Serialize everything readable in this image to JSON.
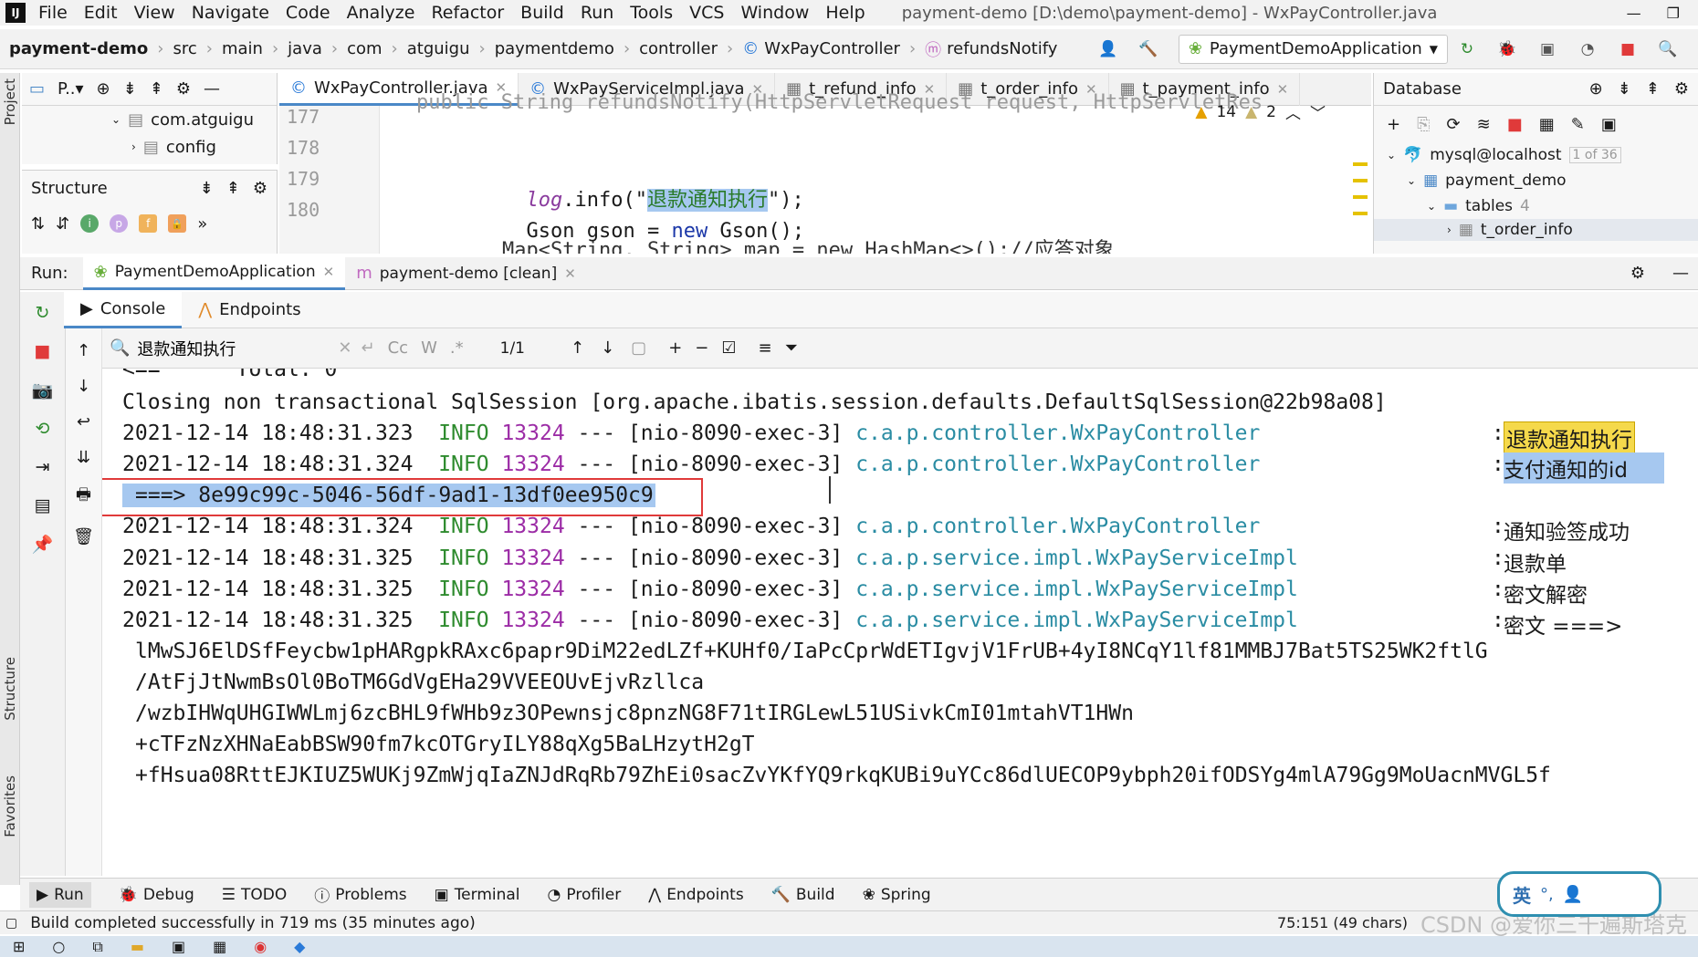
{
  "window": {
    "app_icon": "IJ",
    "menu": [
      "File",
      "Edit",
      "View",
      "Navigate",
      "Code",
      "Analyze",
      "Refactor",
      "Build",
      "Run",
      "Tools",
      "VCS",
      "Window",
      "Help"
    ],
    "title": "payment-demo [D:\\demo\\payment-demo] - WxPayController.java"
  },
  "breadcrumb": [
    "payment-demo",
    "src",
    "main",
    "java",
    "com",
    "atguigu",
    "paymentdemo",
    "controller",
    "WxPayController",
    "refundsNotify"
  ],
  "run_config": {
    "label": "PaymentDemoApplication"
  },
  "project_panel": {
    "tab_label": "P..▾",
    "tree": [
      {
        "label": "com.atguigu"
      },
      {
        "label": "config"
      }
    ]
  },
  "structure_panel": {
    "title": "Structure",
    "filters": [
      "i",
      "p",
      "f"
    ]
  },
  "editor": {
    "tabs": [
      {
        "label": "WxPayController.java",
        "active": true
      },
      {
        "label": "WxPayServiceImpl.java",
        "active": false
      },
      {
        "label": "t_refund_info",
        "active": false
      },
      {
        "label": "t_order_info",
        "active": false
      },
      {
        "label": "t_payment_info",
        "active": false
      }
    ],
    "warnings": "14",
    "weak_warnings": "2",
    "lines": [
      {
        "num": "177",
        "text": ""
      },
      {
        "num": "178",
        "text": "log.info(\"退款通知执行\");",
        "prefix": "log",
        "mid": ".info(\"",
        "str": "退款通知执行",
        "suffix": "\");"
      },
      {
        "num": "179",
        "text": "Gson gson = new Gson();",
        "a": "Gson gson = ",
        "kw": "new",
        "b": " Gson();"
      },
      {
        "num": "180",
        "text": "Map<String, String> map = new HashMap<>();//应答对象"
      }
    ],
    "top_partial": "public String refundsNotify(HttpServletRequest request, HttpServletRes"
  },
  "database": {
    "title": "Database",
    "datasource": "mysql@localhost",
    "datasource_count": "1 of 36",
    "schema": "payment_demo",
    "tables_label": "tables",
    "tables_count": "4",
    "first_table": "t_order_info"
  },
  "run": {
    "label": "Run:",
    "tabs": [
      {
        "label": "PaymentDemoApplication",
        "active": true
      },
      {
        "label": "payment-demo [clean]",
        "active": false
      }
    ],
    "subtabs": [
      "Console",
      "Endpoints"
    ],
    "search_value": "退款通知执行",
    "match_count": "1/1",
    "find_options": [
      "Cc",
      "W",
      ".*"
    ]
  },
  "console": {
    "partial_top": "<==      Total: 0",
    "lines": [
      {
        "type": "plain",
        "text": "Closing non transactional SqlSession [org.apache.ibatis.session.defaults.DefaultSqlSession@22b98a08]"
      },
      {
        "type": "log",
        "time": "2021-12-14 18:48:31.323",
        "level": "INFO",
        "pid": "13324",
        "thread": "--- [nio-8090-exec-3]",
        "logger": "c.a.p.controller.WxPayController",
        "msg": "退款通知执行",
        "highlight": "match"
      },
      {
        "type": "log",
        "time": "2021-12-14 18:48:31.324",
        "level": "INFO",
        "pid": "13324",
        "thread": "--- [nio-8090-exec-3]",
        "logger": "c.a.p.controller.WxPayController",
        "msg": "支付通知的id",
        "highlight": "select"
      },
      {
        "type": "selected",
        "text": "===> 8e99c99c-5046-56df-9ad1-13df0ee950c9"
      },
      {
        "type": "log",
        "time": "2021-12-14 18:48:31.324",
        "level": "INFO",
        "pid": "13324",
        "thread": "--- [nio-8090-exec-3]",
        "logger": "c.a.p.controller.WxPayController",
        "msg": "通知验签成功"
      },
      {
        "type": "log",
        "time": "2021-12-14 18:48:31.325",
        "level": "INFO",
        "pid": "13324",
        "thread": "--- [nio-8090-exec-3]",
        "logger": "c.a.p.service.impl.WxPayServiceImpl",
        "msg": "退款单"
      },
      {
        "type": "log",
        "time": "2021-12-14 18:48:31.325",
        "level": "INFO",
        "pid": "13324",
        "thread": "--- [nio-8090-exec-3]",
        "logger": "c.a.p.service.impl.WxPayServiceImpl",
        "msg": "密文解密"
      },
      {
        "type": "log",
        "time": "2021-12-14 18:48:31.325",
        "level": "INFO",
        "pid": "13324",
        "thread": "--- [nio-8090-exec-3]",
        "logger": "c.a.p.service.impl.WxPayServiceImpl",
        "msg": "密文 ===>"
      },
      {
        "type": "cipher",
        "text": "lMwSJ6ElDSfFeycbw1pHARgpkRAxc6papr9DiM22edLZf+KUHf0/IaPcCprWdETIgvjV1FrUB+4yI8NCqY1lf81MMBJ7Bat5TS25WK2ftlG"
      },
      {
        "type": "cipher",
        "text": "/AtFjJtNwmBsOl0BoTM6GdVgEHa29VVEEOUvEjvRzllca"
      },
      {
        "type": "cipher",
        "text": "/wzbIHWqUHGIWWLmj6zcBHL9fWHb9z3OPewnsjc8pnzNG8F71tIRGLewL51USivkCmI01mtahVT1HWn"
      },
      {
        "type": "cipher",
        "text": "+cTFzNzXHNaEabBSW90fm7kcOTGryILY88qXg5BaLHzytH2gT"
      },
      {
        "type": "cipher",
        "text": "+fHsua08RttEJKIUZ5WUKj9ZmWjqIaZNJdRqRb79ZhEi0sacZvYKfYQ9rkqKUBi9uYCc86dlUECOP9ybph20ifODSYg4mlA79Gg9MoUacnMVGL5f"
      }
    ]
  },
  "toolwindows": [
    "Run",
    "Debug",
    "TODO",
    "Problems",
    "Terminal",
    "Profiler",
    "Endpoints",
    "Build",
    "Spring"
  ],
  "status": {
    "message": "Build completed successfully in 719 ms (35 minutes ago)",
    "position": "75:151 (49 chars)",
    "watermark": "CSDN @爱你三千遍斯塔克"
  },
  "ime": {
    "label": "英"
  },
  "side_labels": {
    "project": "Project",
    "structure": "Structure",
    "favorites": "Favorites"
  },
  "colors": {
    "accent": "#4a88c7",
    "info": "#2e8b2e",
    "pid": "#9c2ca6",
    "logger": "#2a8ca3",
    "match_bg": "#f5d94b",
    "select_bg": "#a6c8f0",
    "red_box": "#e03a3a"
  }
}
